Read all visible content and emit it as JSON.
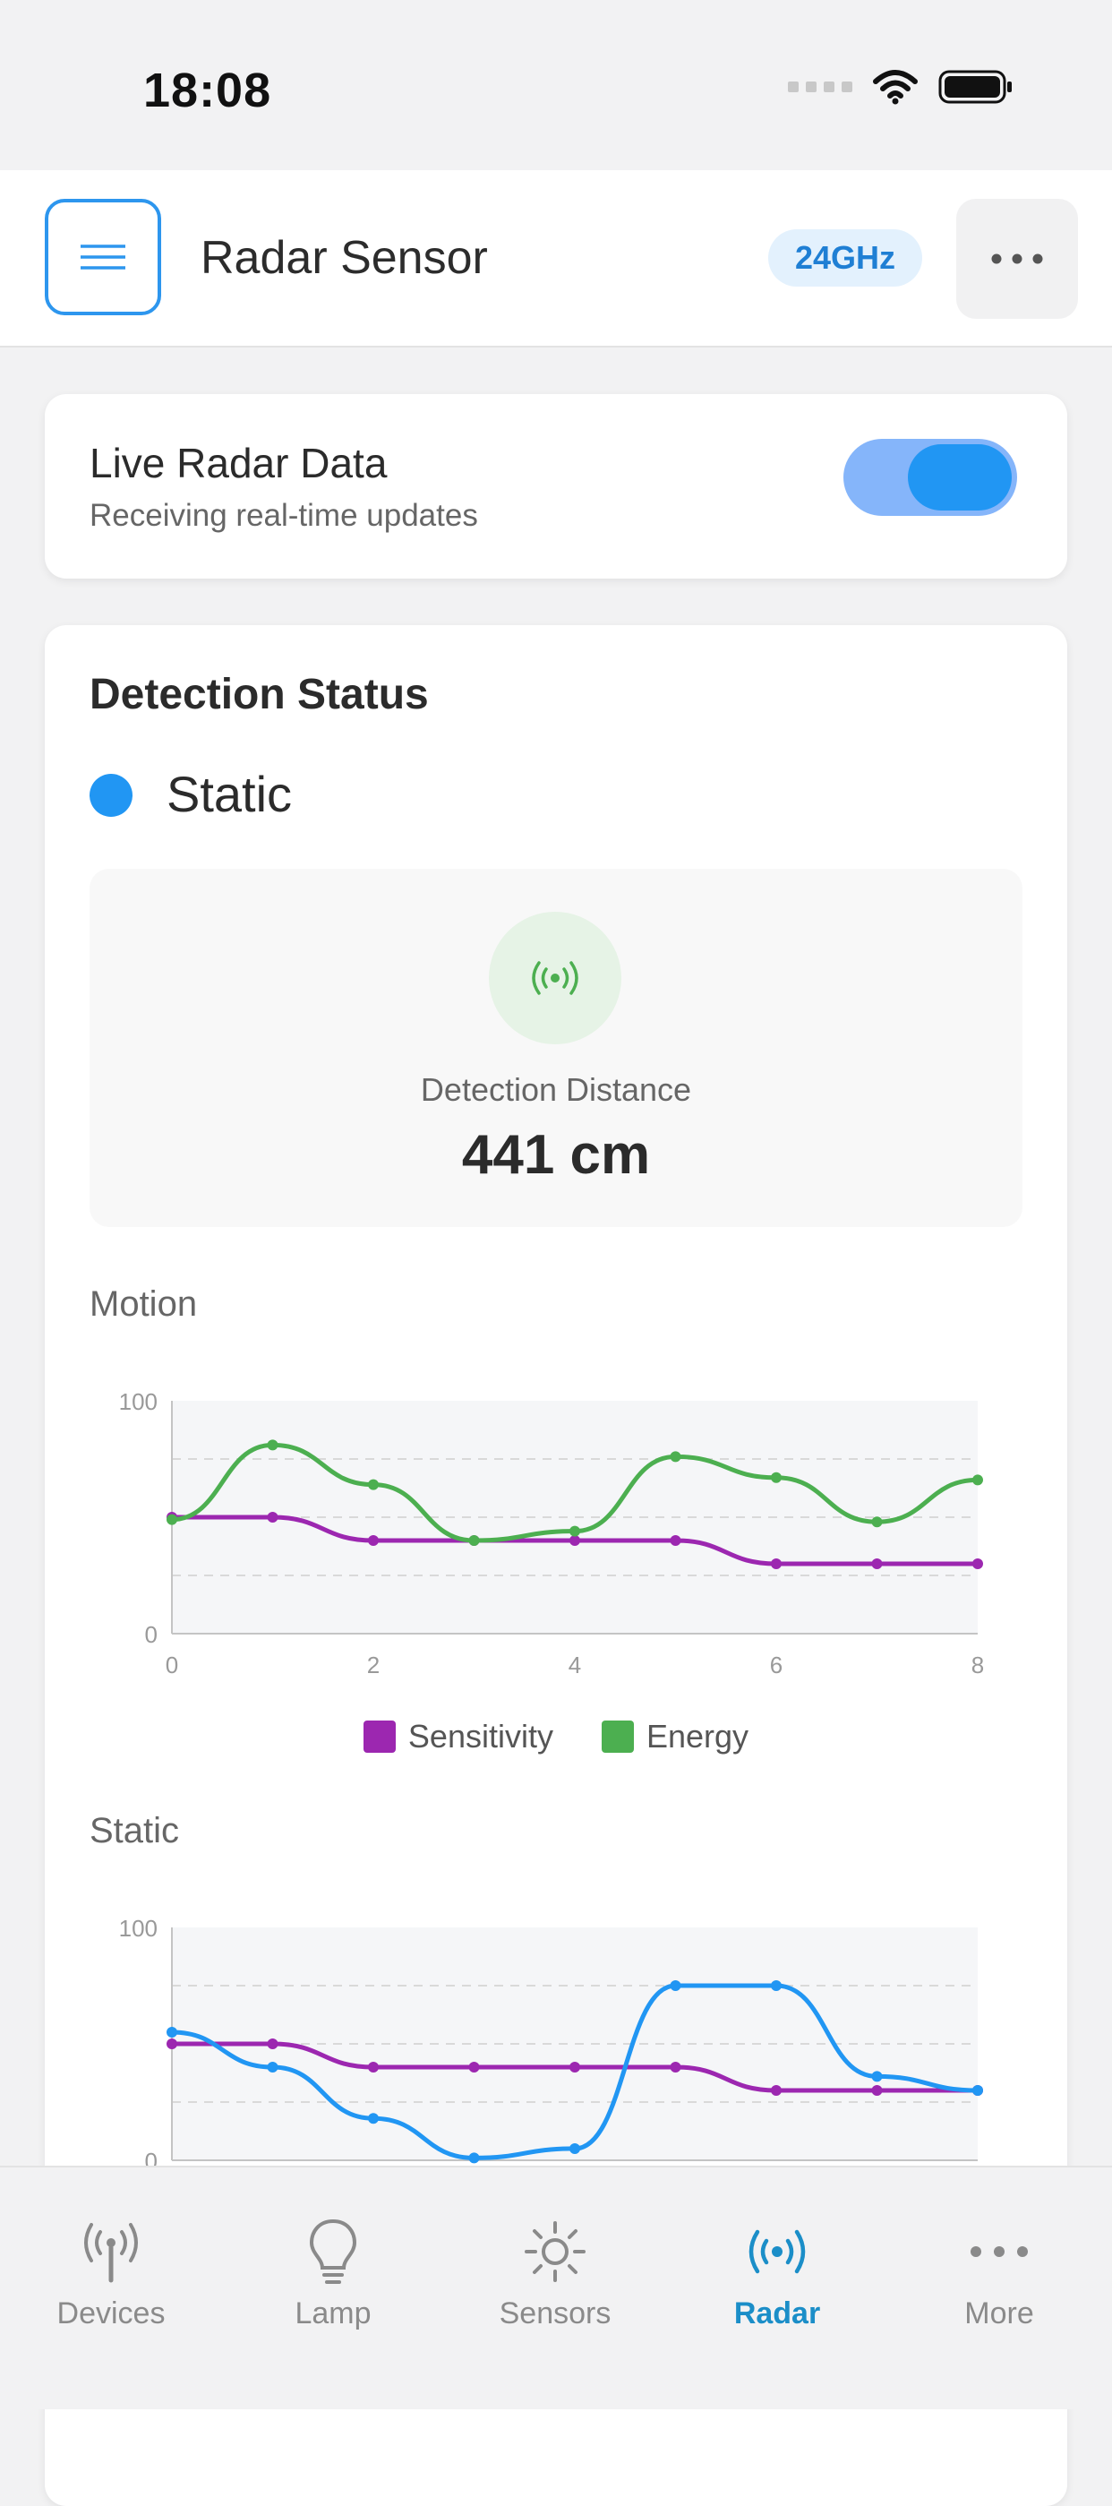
{
  "status_bar": {
    "time": "18:08"
  },
  "header": {
    "title": "Radar Sensor",
    "badge": "24GHz"
  },
  "live_card": {
    "title": "Live Radar Data",
    "subtitle": "Receiving real-time updates",
    "toggle_on": true
  },
  "detection": {
    "title": "Detection Status",
    "state": "Static",
    "state_color": "#2196f3",
    "distance_label": "Detection Distance",
    "distance_value": "441 cm"
  },
  "charts": {
    "motion_title": "Motion",
    "static_title": "Static",
    "legend": [
      {
        "label": "Sensitivity",
        "color": "#9c27b0"
      },
      {
        "label": "Energy",
        "color": "#4caf50"
      }
    ]
  },
  "chart_data": [
    {
      "type": "line",
      "x": [
        0,
        1,
        2,
        3,
        4,
        5,
        6,
        7,
        8
      ],
      "xticks": [
        "0",
        "2",
        "4",
        "6",
        "8"
      ],
      "yticks": [
        "0",
        "100"
      ],
      "ylim": [
        0,
        100
      ],
      "series": [
        {
          "name": "Sensitivity",
          "color": "#9c27b0",
          "values": [
            50,
            50,
            40,
            40,
            40,
            40,
            30,
            30,
            30
          ]
        },
        {
          "name": "Energy",
          "color": "#4caf50",
          "values": [
            49,
            81,
            64,
            40,
            44,
            76,
            67,
            48,
            66
          ]
        }
      ]
    },
    {
      "type": "line",
      "x": [
        0,
        1,
        2,
        3,
        4,
        5,
        6,
        7,
        8
      ],
      "yticks": [
        "0",
        "100"
      ],
      "ylim": [
        0,
        100
      ],
      "series": [
        {
          "name": "Sensitivity",
          "color": "#9c27b0",
          "values": [
            50,
            50,
            40,
            40,
            40,
            40,
            30,
            30,
            30
          ]
        },
        {
          "color": "#2196f3",
          "values": [
            55,
            40,
            18,
            1,
            5,
            75,
            75,
            36,
            30
          ]
        }
      ]
    }
  ],
  "tabs": [
    {
      "label": "Devices",
      "icon": "antenna-icon",
      "active": false
    },
    {
      "label": "Lamp",
      "icon": "lightbulb-icon",
      "active": false
    },
    {
      "label": "Sensors",
      "icon": "sun-icon",
      "active": false
    },
    {
      "label": "Radar",
      "icon": "radar-icon",
      "active": true
    },
    {
      "label": "More",
      "icon": "more-icon",
      "active": false
    }
  ],
  "accent_color": "#1b8ec8"
}
